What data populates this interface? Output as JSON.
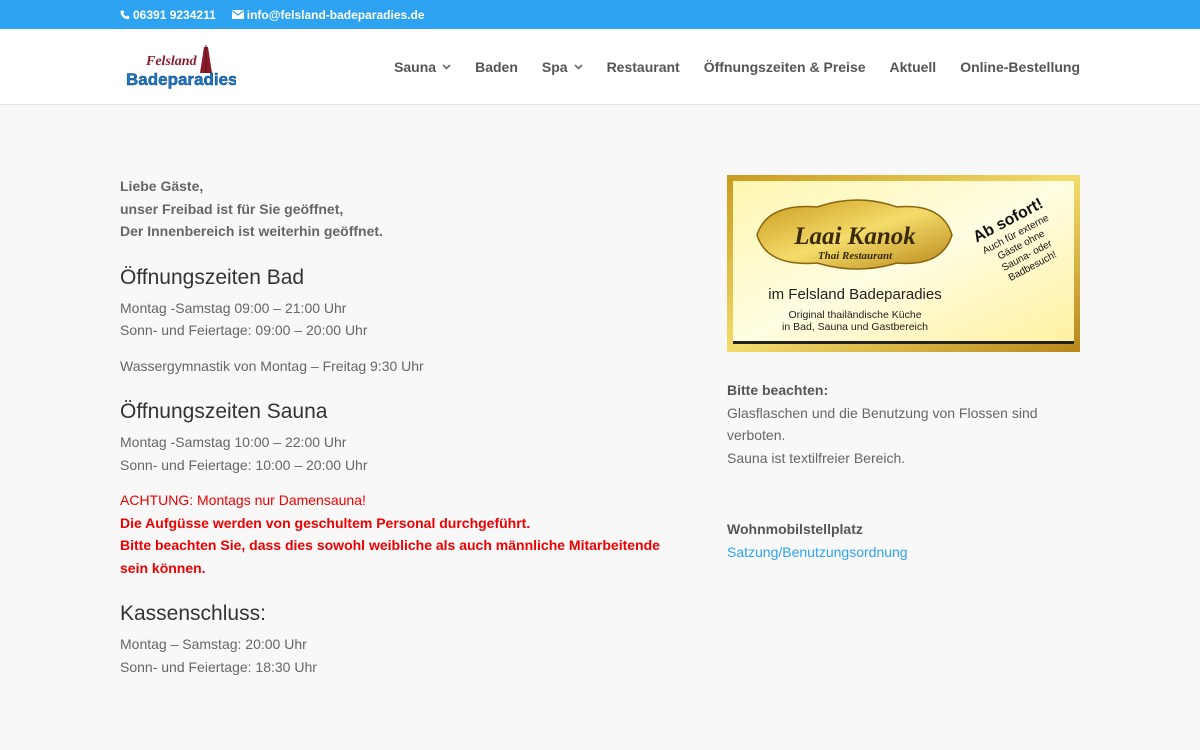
{
  "topbar": {
    "phone": "06391 9234211",
    "email": "info@felsland-badeparadies.de"
  },
  "logo": {
    "line1": "Felsland",
    "line2": "Badeparadies"
  },
  "nav": [
    {
      "label": "Sauna",
      "dropdown": true
    },
    {
      "label": "Baden",
      "dropdown": false
    },
    {
      "label": "Spa",
      "dropdown": true
    },
    {
      "label": "Restaurant",
      "dropdown": false
    },
    {
      "label": "Öffnungszeiten & Preise",
      "dropdown": false
    },
    {
      "label": "Aktuell",
      "dropdown": false
    },
    {
      "label": "Online-Bestellung",
      "dropdown": false
    }
  ],
  "intro": {
    "line1": "Liebe Gäste,",
    "line2": "unser Freibad ist für Sie geöffnet,",
    "line3": "Der Innenbereich ist weiterhin geöffnet."
  },
  "bad": {
    "heading": "Öffnungszeiten Bad",
    "line1": "Montag -Samstag 09:00 – 21:00 Uhr",
    "line2": "Sonn- und Feiertage: 09:00 – 20:00 Uhr",
    "line3": "Wassergymnastik von Montag – Freitag 9:30 Uhr"
  },
  "sauna": {
    "heading": "Öffnungszeiten Sauna",
    "line1": "Montag -Samstag 10:00 – 22:00 Uhr",
    "line2": "Sonn- und Feiertage: 10:00 – 20:00 Uhr",
    "warn1": "ACHTUNG: Montags nur Damensauna!",
    "warn2": "Die Aufgüsse werden von geschultem Personal durchgeführt.",
    "warn3": "Bitte beachten Sie, dass dies sowohl weibliche als auch männliche Mitarbeitende sein können."
  },
  "kasse": {
    "heading": "Kassenschluss:",
    "line1": "Montag – Samstag: 20:00 Uhr",
    "line2": "Sonn- und Feiertage: 18:30 Uhr"
  },
  "banner": {
    "name": "Laai Kanok",
    "sub": "Thai Restaurant",
    "place": "im Felsland Badeparadies",
    "desc1": "Original thailändische Küche",
    "desc2": "in Bad, Sauna und Gastbereich",
    "stamp1": "Ab sofort!",
    "stamp2": "Auch für externe",
    "stamp3": "Gäste ohne",
    "stamp4": "Sauna- oder",
    "stamp5": "Badbesuch!"
  },
  "notice": {
    "label": "Bitte beachten:",
    "line1": "Glasflaschen und die Benutzung von Flossen sind verboten.",
    "line2": "Sauna ist textilfreier Bereich."
  },
  "camper": {
    "label": "Wohnmobilstellplatz",
    "link": "Satzung/Benutzungsordnung"
  },
  "colors": {
    "accent": "#2ea3f2",
    "warning": "#ee0000",
    "gold": "#e8c84a"
  }
}
